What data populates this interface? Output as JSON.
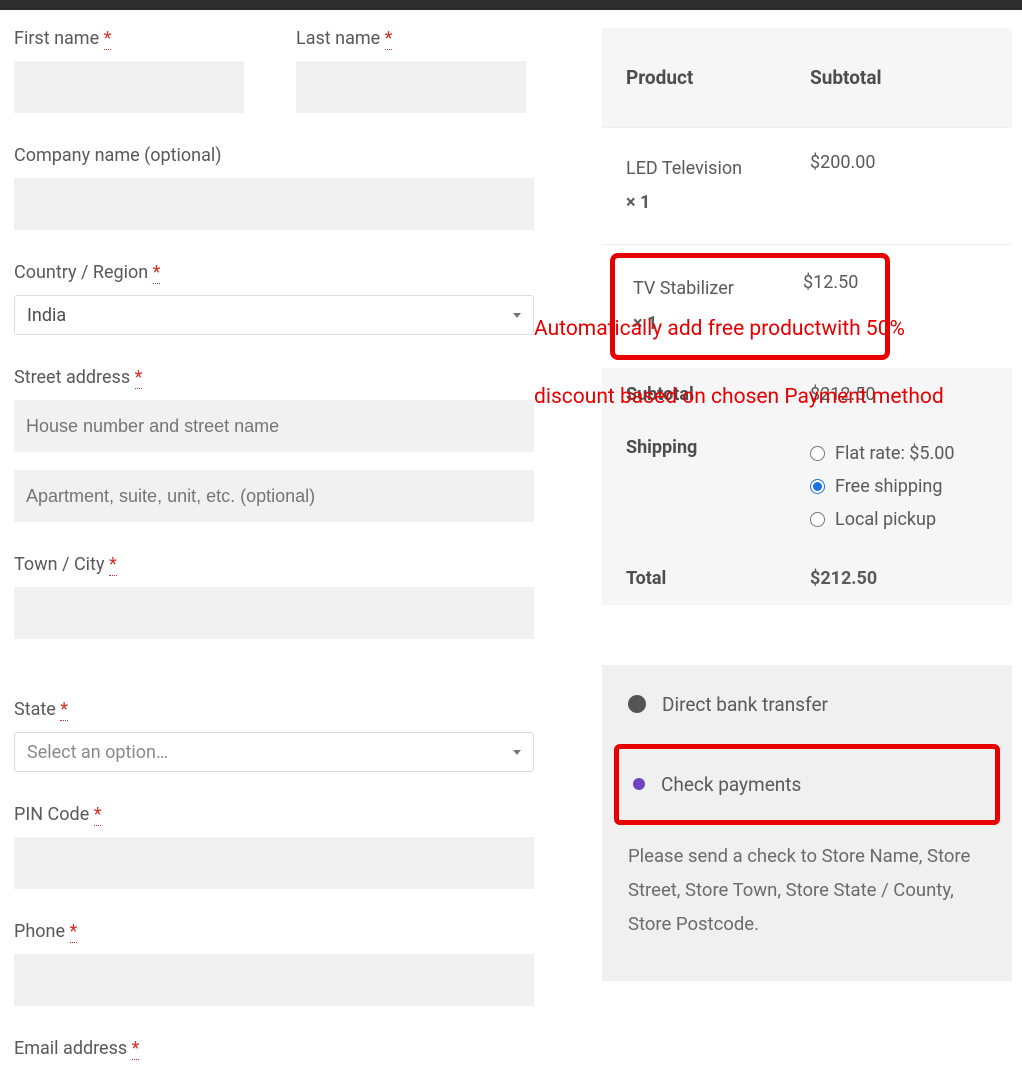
{
  "billing": {
    "first_name_label": "First name",
    "last_name_label": "Last name",
    "company_label": "Company name (optional)",
    "country_label": "Country / Region",
    "country_value": "India",
    "street_label": "Street address",
    "street1_placeholder": "House number and street name",
    "street2_placeholder": "Apartment, suite, unit, etc. (optional)",
    "city_label": "Town / City",
    "state_label": "State",
    "state_placeholder": "Select an option…",
    "pin_label": "PIN Code",
    "phone_label": "Phone",
    "email_label": "Email address",
    "required_mark": "*"
  },
  "order": {
    "head_product": "Product",
    "head_subtotal": "Subtotal",
    "items": [
      {
        "name": "LED Television",
        "qty": "× 1",
        "price": "$200.00"
      },
      {
        "name": "TV Stabilizer",
        "qty": "× 1",
        "price": "$12.50"
      }
    ],
    "subtotal_label": "Subtotal",
    "subtotal_value": "$212.50",
    "shipping_label": "Shipping",
    "shipping_options": [
      {
        "label": "Flat rate: $5.00",
        "checked": false
      },
      {
        "label": "Free shipping",
        "checked": true
      },
      {
        "label": "Local pickup",
        "checked": false
      }
    ],
    "total_label": "Total",
    "total_value": "$212.50"
  },
  "payment": {
    "options": [
      {
        "label": "Direct bank transfer",
        "checked": false
      },
      {
        "label": "Check payments",
        "checked": true
      }
    ],
    "description": "Please send a check to Store Name, Store Street, Store Town, Store State / County, Store Postcode."
  },
  "annotation": {
    "line1": "Automatically add free productwith 50%",
    "line2": "discount based on chosen Payment method"
  }
}
